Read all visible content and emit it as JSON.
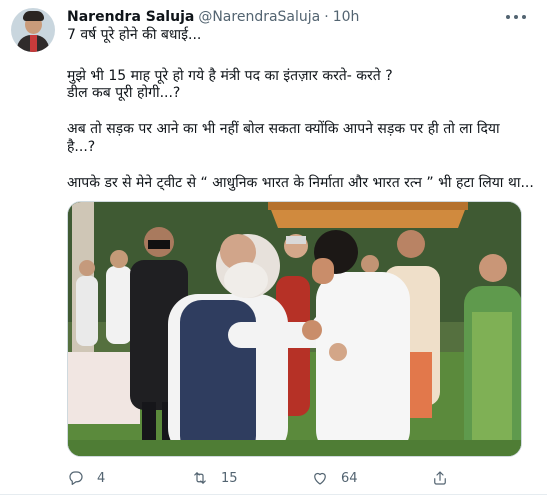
{
  "tweet": {
    "author_name": "Narendra Saluja",
    "handle": "@NarendraSaluja",
    "separator": "·",
    "time": "10h",
    "lines": [
      "7 वर्ष पूरे होने की बधाई...",
      "मुझे भी 15 माह पूरे हो गये है मंत्री पद का इंतज़ार करते- करते ?",
      "डील कब पूरी होगी...?",
      "अब तो सड़क पर आने का भी नहीं बोल सकता क्योंकि आपने सड़क पर ही तो ला दिया",
      "है...?",
      "आपके डर से मेने ट्वीट से “ आधुनिक भारत के निर्माता और भारत रत्न ” भी हटा लिया था..."
    ]
  },
  "actions": {
    "reply_count": "4",
    "retweet_count": "15",
    "like_count": "64"
  },
  "icons": {
    "more": "more-dots-icon",
    "reply": "reply-icon",
    "retweet": "retweet-icon",
    "like": "heart-icon",
    "share": "share-icon"
  },
  "colors": {
    "secondary_text": "#536471",
    "primary_text": "#0f1419",
    "divider": "#e6ecf0"
  }
}
